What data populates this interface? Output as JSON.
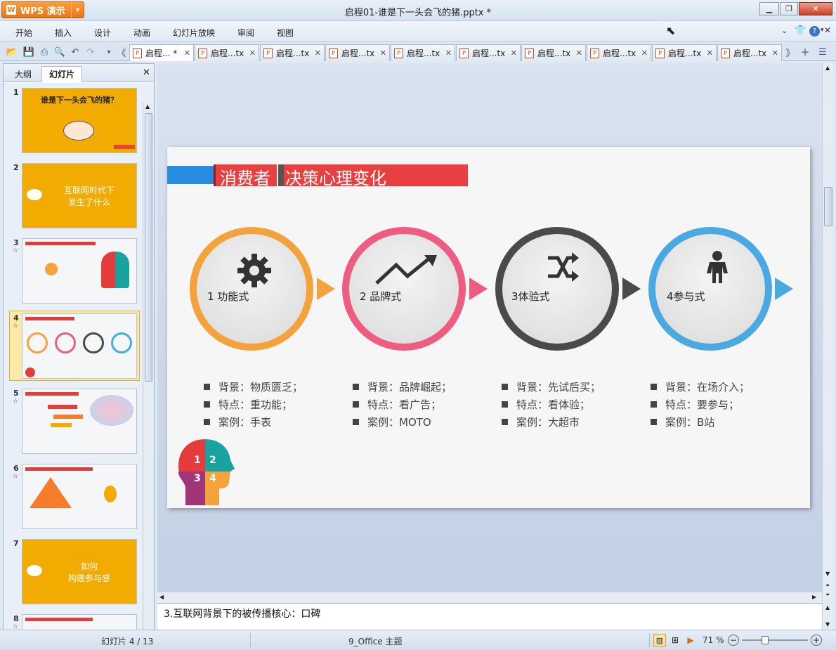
{
  "app": {
    "name": "WPS 演示",
    "title": "启程01-谁是下一头会飞的猪.pptx *"
  },
  "menu": [
    "开始",
    "插入",
    "设计",
    "动画",
    "幻灯片放映",
    "审阅",
    "视图"
  ],
  "doc_tabs": [
    {
      "label": "启程... *",
      "active": true
    },
    {
      "label": "启程...tx"
    },
    {
      "label": "启程...tx"
    },
    {
      "label": "启程...tx"
    },
    {
      "label": "启程...tx"
    },
    {
      "label": "启程...tx"
    },
    {
      "label": "启程...tx"
    },
    {
      "label": "启程...tx"
    },
    {
      "label": "启程...tx"
    },
    {
      "label": "启程...tx"
    }
  ],
  "panel": {
    "tab_outline": "大纲",
    "tab_slides": "幻灯片"
  },
  "thumbnails": [
    {
      "num": "1",
      "title": "谁是下一头会飞的猪？"
    },
    {
      "num": "2",
      "line1": "互联网时代下",
      "line2": "发生了什么"
    },
    {
      "num": "3",
      "star": "☆"
    },
    {
      "num": "4",
      "star": "☆"
    },
    {
      "num": "5",
      "star": "☆"
    },
    {
      "num": "6",
      "star": "☆"
    },
    {
      "num": "7",
      "line1": "如何",
      "line2": "构建参与感"
    },
    {
      "num": "8",
      "star": "☆"
    }
  ],
  "slide": {
    "title_part1": "消费者",
    "title_part2": "决策心理变化",
    "circles": [
      {
        "label": "1 功能式",
        "color": "#f4a33c",
        "icon": "gear-icon"
      },
      {
        "label": "2 品牌式",
        "color": "#ee5c80",
        "icon": "trend-arrow-icon"
      },
      {
        "label": "3体验式",
        "color": "#4a4a4a",
        "icon": "shuffle-icon"
      },
      {
        "label": "4参与式",
        "color": "#4aa9e0",
        "icon": "person-icon"
      }
    ],
    "lists": [
      [
        "背景：物质匮乏；",
        "特点：重功能；",
        "案例：手表"
      ],
      [
        "背景：品牌崛起；",
        "特点：看广告；",
        "案例：MOTO"
      ],
      [
        "背景：先试后买；",
        "特点：看体验；",
        "案例：大超市"
      ],
      [
        "背景：在场介入；",
        "特点：要参与；",
        "案例：B站"
      ]
    ],
    "head_numbers": [
      "1",
      "2",
      "3",
      "4"
    ]
  },
  "notes": "3.互联网背景下的被传播核心：口碑",
  "status": {
    "slide_counter": "幻灯片 4 / 13",
    "theme": "9_Office 主题",
    "zoom": "71 %"
  }
}
